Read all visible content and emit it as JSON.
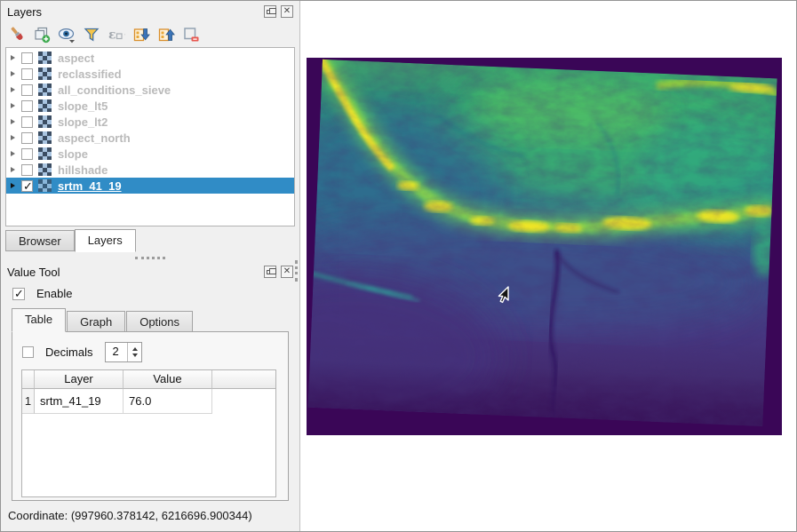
{
  "layers_panel": {
    "title": "Layers",
    "window_buttons": [
      "float-icon",
      "close-icon"
    ],
    "toolbar_icons": [
      "styling-brush-icon",
      "add-group-icon",
      "map-themes-eye-icon",
      "filter-legend-icon",
      "expression-filter-epsilon-icon",
      "expand-all-icon",
      "collapse-all-icon",
      "remove-layer-icon"
    ],
    "layers": [
      {
        "name": "aspect",
        "checked": false,
        "selected": false
      },
      {
        "name": "reclassified",
        "checked": false,
        "selected": false
      },
      {
        "name": "all_conditions_sieve",
        "checked": false,
        "selected": false
      },
      {
        "name": "slope_lt5",
        "checked": false,
        "selected": false
      },
      {
        "name": "slope_lt2",
        "checked": false,
        "selected": false
      },
      {
        "name": "aspect_north",
        "checked": false,
        "selected": false
      },
      {
        "name": "slope",
        "checked": false,
        "selected": false
      },
      {
        "name": "hillshade",
        "checked": false,
        "selected": false
      },
      {
        "name": "srtm_41_19",
        "checked": true,
        "selected": true
      }
    ],
    "bottom_tabs": [
      {
        "label": "Browser",
        "active": false
      },
      {
        "label": "Layers",
        "active": true
      }
    ]
  },
  "value_tool": {
    "title": "Value Tool",
    "window_buttons": [
      "float-icon",
      "close-icon"
    ],
    "enable": {
      "label": "Enable",
      "checked": true
    },
    "tabs": [
      {
        "label": "Table",
        "active": true
      },
      {
        "label": "Graph",
        "active": false
      },
      {
        "label": "Options",
        "active": false
      }
    ],
    "decimals": {
      "label": "Decimals",
      "checked": false,
      "value": "2"
    },
    "table": {
      "headers": [
        "Layer",
        "Value"
      ],
      "rows": [
        {
          "num": "1",
          "layer": "srtm_41_19",
          "value": "76.0"
        }
      ]
    }
  },
  "status": {
    "coordinate": "Coordinate: (997960.378142, 6216696.900344)"
  },
  "map": {
    "layer_shown": "srtm_41_19",
    "style": "viridis elevation colormap, raster rotated ~2.4deg in canvas",
    "colors": {
      "selection_blue": "#308cc6",
      "nodata_purple": "#3a0657",
      "low_elevation": "#46327e",
      "mid_elevation": "#31688e",
      "high_elevation": "#35b779",
      "ridge_yellow": "#f6e626"
    }
  }
}
